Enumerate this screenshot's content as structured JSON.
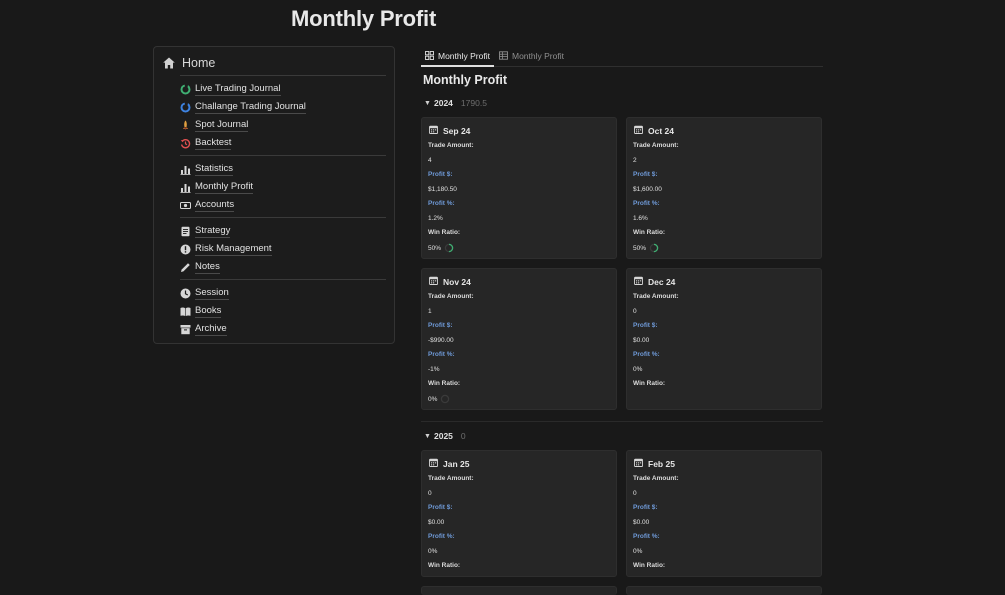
{
  "page": {
    "title": "Monthly Profit"
  },
  "nav": {
    "home": "Home",
    "groups": [
      [
        {
          "label": "Live Trading Journal",
          "icon": "green-circle-arrows-icon"
        },
        {
          "label": "Challange Trading Journal",
          "icon": "blue-circle-arrows-icon"
        },
        {
          "label": "Spot Journal",
          "icon": "rocket-icon"
        },
        {
          "label": "Backtest",
          "icon": "rewind-clock-icon"
        }
      ],
      [
        {
          "label": "Statistics",
          "icon": "bar-chart-icon"
        },
        {
          "label": "Monthly Profit",
          "icon": "bar-chart-icon"
        },
        {
          "label": "Accounts",
          "icon": "money-icon"
        }
      ],
      [
        {
          "label": "Strategy",
          "icon": "document-icon"
        },
        {
          "label": "Risk Management",
          "icon": "alert-icon"
        },
        {
          "label": "Notes",
          "icon": "pencil-icon"
        }
      ],
      [
        {
          "label": "Session",
          "icon": "clock-icon"
        },
        {
          "label": "Books",
          "icon": "book-icon"
        },
        {
          "label": "Archive",
          "icon": "archive-icon"
        }
      ]
    ]
  },
  "tabs": [
    {
      "label": "Monthly Profit",
      "icon": "gallery-icon",
      "active": true
    },
    {
      "label": "Monthly Profit",
      "icon": "table-icon",
      "active": false
    }
  ],
  "section_title": "Monthly Profit",
  "field_labels": {
    "trade_amount": "Trade Amount:",
    "profit_usd": "Profit $:",
    "profit_pct": "Profit %:",
    "win_ratio": "Win Ratio:"
  },
  "groups": [
    {
      "year": "2024",
      "sum": "1790.5",
      "cards": [
        {
          "title": "Sep 24",
          "trade_amount": "4",
          "profit_usd": "$1,180.50",
          "profit_pct": "1.2%",
          "win_ratio": "50%",
          "win_fraction": 0.5
        },
        {
          "title": "Oct 24",
          "trade_amount": "2",
          "profit_usd": "$1,600.00",
          "profit_pct": "1.6%",
          "win_ratio": "50%",
          "win_fraction": 0.5
        },
        {
          "title": "Nov 24",
          "trade_amount": "1",
          "profit_usd": "-$990.00",
          "profit_pct": "-1%",
          "win_ratio": "0%",
          "win_fraction": 0
        },
        {
          "title": "Dec 24",
          "trade_amount": "0",
          "profit_usd": "$0.00",
          "profit_pct": "0%",
          "win_ratio": "",
          "win_fraction": null
        }
      ]
    },
    {
      "year": "2025",
      "sum": "0",
      "cards": [
        {
          "title": "Jan 25",
          "trade_amount": "0",
          "profit_usd": "$0.00",
          "profit_pct": "0%",
          "win_ratio": "",
          "win_fraction": null
        },
        {
          "title": "Feb 25",
          "trade_amount": "0",
          "profit_usd": "$0.00",
          "profit_pct": "0%",
          "win_ratio": "",
          "win_fraction": null
        }
      ]
    }
  ],
  "colors": {
    "background": "#191919",
    "card": "#262626",
    "profit_label": "#6f9ad8",
    "ring_progress": "#3fae72",
    "ring_track": "#3a3a3a"
  }
}
